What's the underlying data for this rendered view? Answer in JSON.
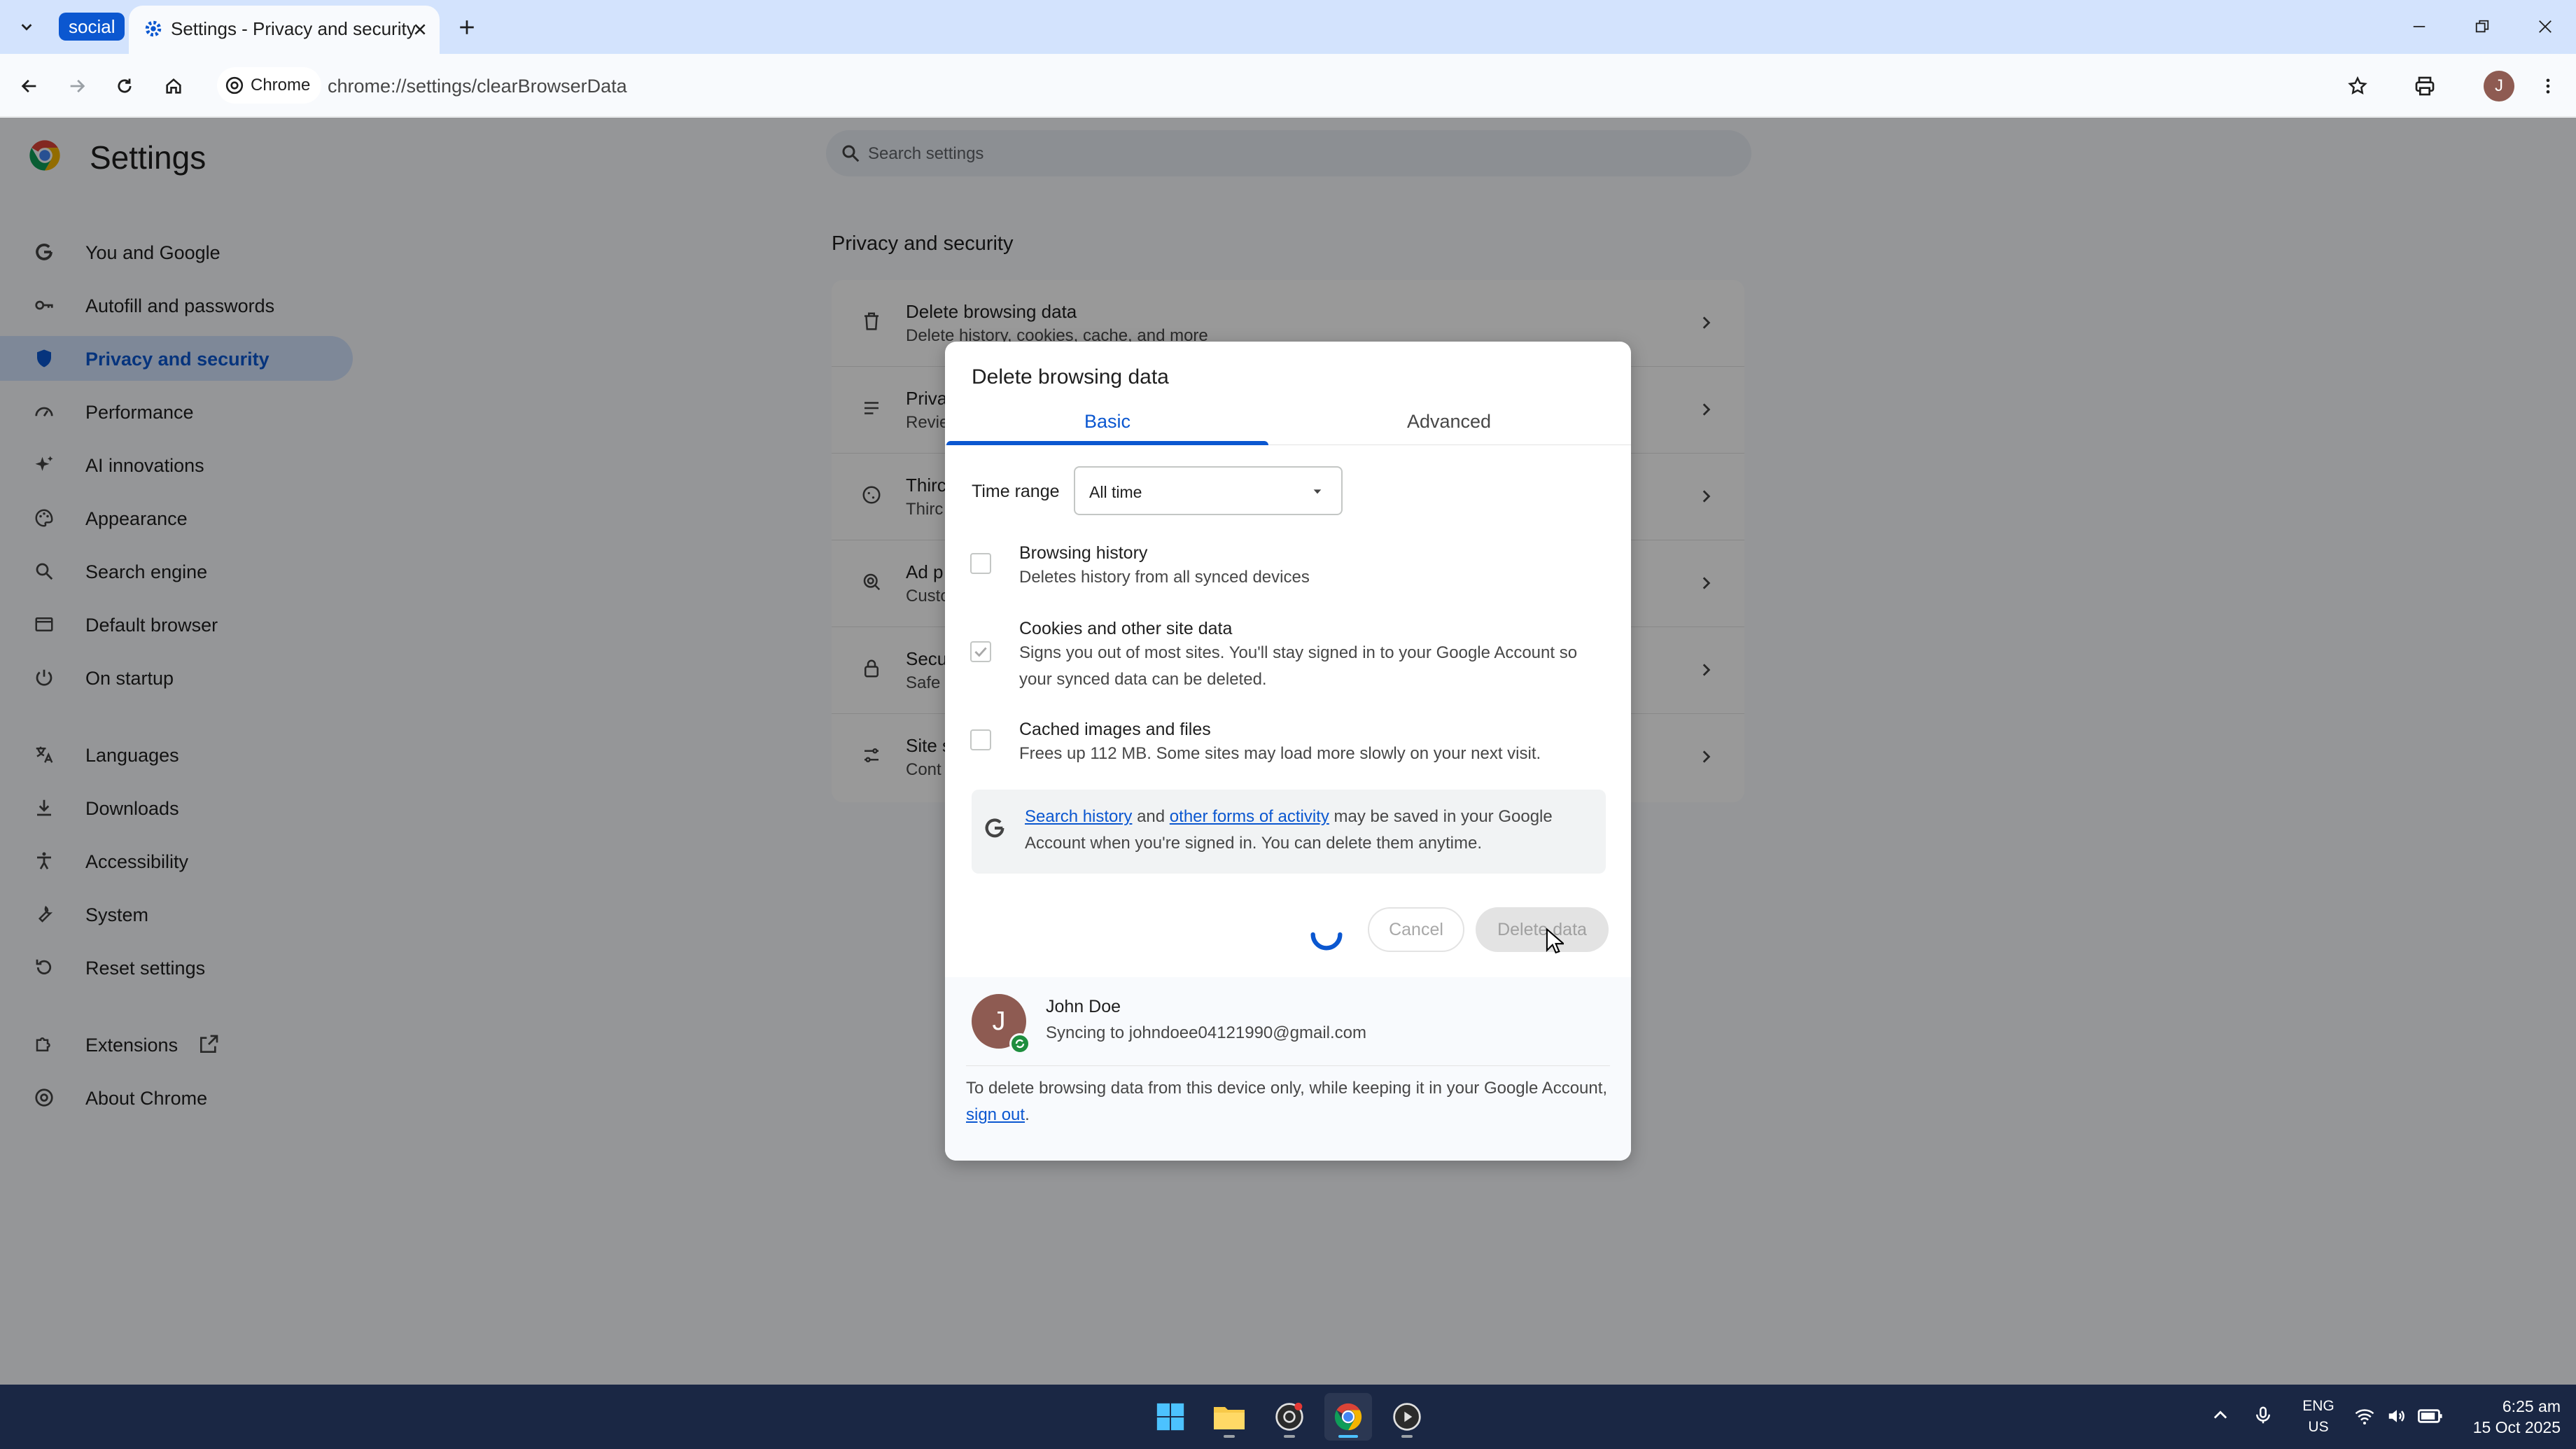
{
  "tabstrip": {
    "group_label": "social",
    "active_tab_title": "Settings - Privacy and security"
  },
  "toolbar": {
    "site_chip_label": "Chrome",
    "url": "chrome://settings/clearBrowserData",
    "avatar_initial": "J"
  },
  "settings": {
    "title": "Settings",
    "search_placeholder": "Search settings",
    "nav": [
      {
        "label": "You and Google",
        "icon": "google-g-icon"
      },
      {
        "label": "Autofill and passwords",
        "icon": "key-icon"
      },
      {
        "label": "Privacy and security",
        "icon": "shield-icon",
        "active": true
      },
      {
        "label": "Performance",
        "icon": "gauge-icon"
      },
      {
        "label": "AI innovations",
        "icon": "sparkle-icon"
      },
      {
        "label": "Appearance",
        "icon": "palette-icon"
      },
      {
        "label": "Search engine",
        "icon": "search-icon"
      },
      {
        "label": "Default browser",
        "icon": "browser-window-icon"
      },
      {
        "label": "On startup",
        "icon": "power-icon"
      },
      {
        "label": "Languages",
        "icon": "translate-icon"
      },
      {
        "label": "Downloads",
        "icon": "download-icon"
      },
      {
        "label": "Accessibility",
        "icon": "accessibility-icon"
      },
      {
        "label": "System",
        "icon": "wrench-icon"
      },
      {
        "label": "Reset settings",
        "icon": "reset-icon"
      },
      {
        "label": "Extensions",
        "icon": "puzzle-icon"
      },
      {
        "label": "About Chrome",
        "icon": "chrome-icon"
      }
    ],
    "section_title": "Privacy and security",
    "card_rows": [
      {
        "title": "Delete browsing data",
        "sub": "Delete history, cookies, cache, and more",
        "icon": "trash-icon"
      },
      {
        "title": "Priva",
        "sub": "Revie",
        "icon": "tune-icon"
      },
      {
        "title": "Thirc",
        "sub": "Thirc",
        "icon": "cookie-icon"
      },
      {
        "title": "Ad p",
        "sub": "Custo",
        "icon": "ad-privacy-icon"
      },
      {
        "title": "Secu",
        "sub": "Safe",
        "icon": "lock-icon"
      },
      {
        "title": "Site s",
        "sub": "Cont",
        "icon": "sliders-icon"
      }
    ]
  },
  "dialog": {
    "title": "Delete browsing data",
    "tabs": {
      "basic": "Basic",
      "advanced": "Advanced"
    },
    "time_range_label": "Time range",
    "time_range_value": "All time",
    "options": [
      {
        "title": "Browsing history",
        "sub": "Deletes history from all synced devices",
        "checked": false
      },
      {
        "title": "Cookies and other site data",
        "sub": "Signs you out of most sites. You'll stay signed in to your Google Account so your synced data can be deleted.",
        "checked": true
      },
      {
        "title": "Cached images and files",
        "sub": "Frees up 112 MB. Some sites may load more slowly on your next visit.",
        "checked": false
      }
    ],
    "info": {
      "link1": "Search history",
      "and": " and ",
      "link2": "other forms of activity",
      "rest": " may be saved in your Google Account when you're signed in. You can delete them anytime."
    },
    "cancel_label": "Cancel",
    "delete_label": "Delete data",
    "account": {
      "initial": "J",
      "name": "John Doe",
      "sync": "Syncing to johndoee04121990@gmail.com"
    },
    "signout": {
      "prefix": "To delete browsing data from this device only, while keeping it in your Google Account, ",
      "link": "sign out",
      "suffix": "."
    }
  },
  "taskbar": {
    "lang_top": "ENG",
    "lang_bottom": "US",
    "time": "6:25 am",
    "date": "15 Oct 2025"
  }
}
